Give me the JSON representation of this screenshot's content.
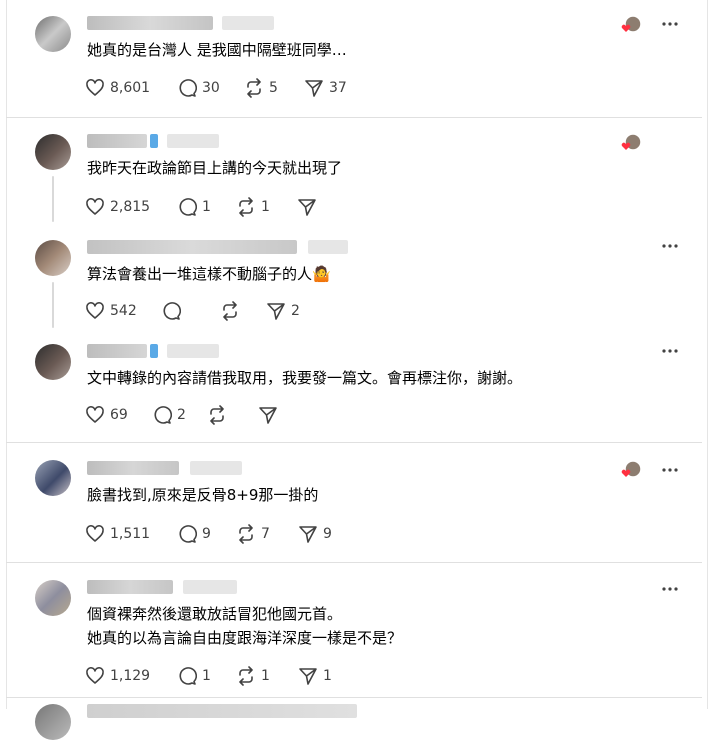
{
  "posts": [
    {
      "text_lines": [
        "她真的是台灣人 是我國中隔壁班同學…"
      ],
      "likes": "8,601",
      "replies": "30",
      "reposts": "5",
      "shares": "37",
      "liked_by_author": true
    },
    {
      "text_lines": [
        "我昨天在政論節目上講的今天就出現了"
      ],
      "likes": "2,815",
      "replies": "1",
      "reposts": "1",
      "shares": "",
      "liked_by_author": true
    },
    {
      "text_lines": [
        "算法會養出一堆這樣不動腦子的人🤷"
      ],
      "likes": "542",
      "replies": "",
      "reposts": "",
      "shares": "2",
      "liked_by_author": false
    },
    {
      "text_lines": [
        "文中轉錄的內容請借我取用，我要發一篇文。會再標注你，謝謝。"
      ],
      "likes": "69",
      "replies": "2",
      "reposts": "",
      "shares": "",
      "liked_by_author": false
    },
    {
      "text_lines": [
        "臉書找到,原來是反骨8+9那一掛的"
      ],
      "likes": "1,511",
      "replies": "9",
      "reposts": "7",
      "shares": "9",
      "liked_by_author": true
    },
    {
      "text_lines": [
        "個資裸奔然後還敢放話冒犯他國元首。",
        "她真的以為言論自由度跟海洋深度一樣是不是？"
      ],
      "likes": "1,129",
      "replies": "1",
      "reposts": "1",
      "shares": "1",
      "liked_by_author": false
    }
  ],
  "icons": {
    "like": "heart-icon",
    "reply": "comment-icon",
    "repost": "repost-icon",
    "share": "send-icon",
    "more": "more-horizontal-icon"
  },
  "colors": {
    "liked_heart": "#ff3040",
    "action": "#424242",
    "divider": "#e0e0e0"
  }
}
